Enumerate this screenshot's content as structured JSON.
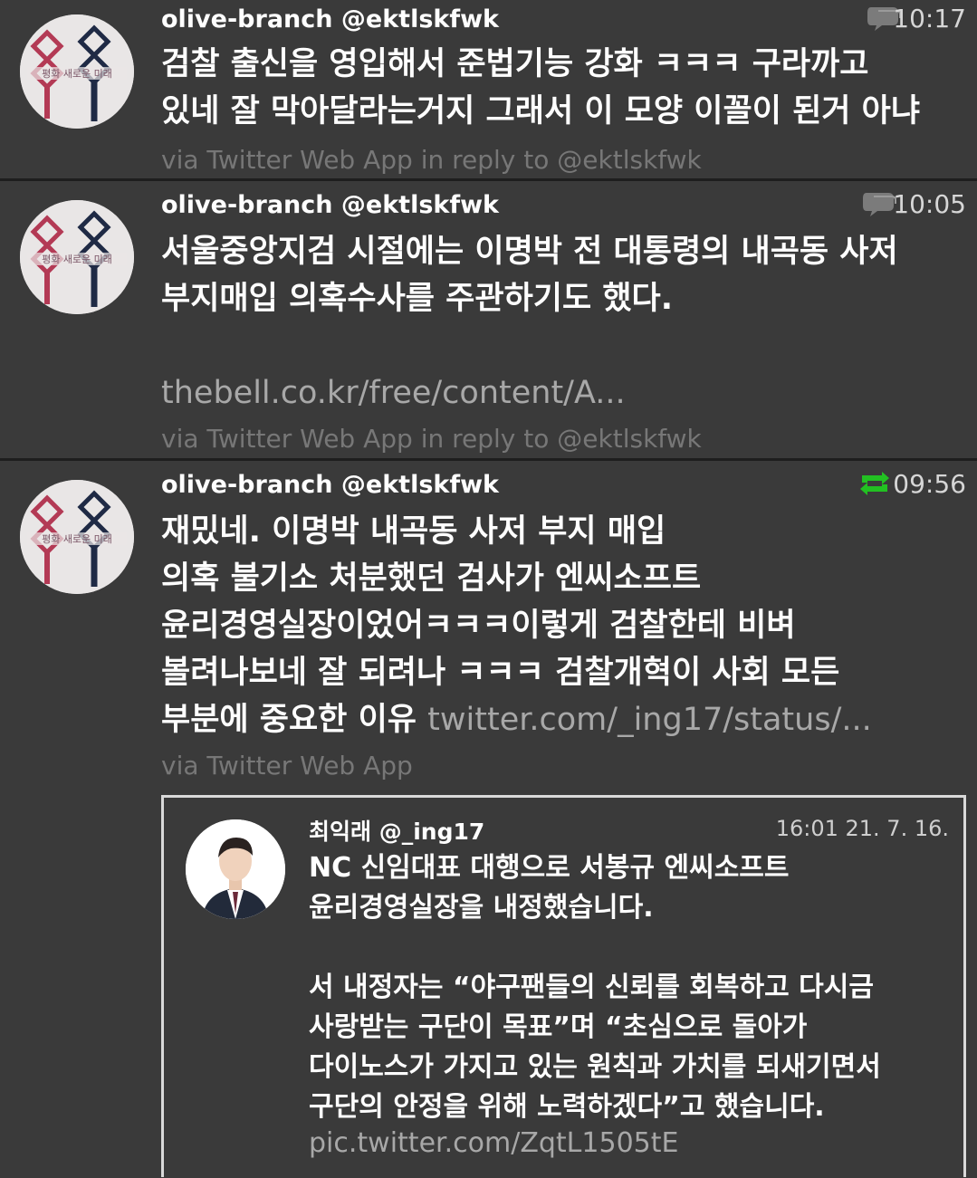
{
  "tweets": [
    {
      "user": "olive-branch @ektlskfwk",
      "time": "10:17",
      "icon": "reply-bubble-icon",
      "lines": [
        "검찰 출신을 영입해서 준법기능 강화 ㅋㅋㅋ 구라까고",
        "있네 잘 막아달라는거지 그래서 이 모양 이꼴이 된거 아냐"
      ],
      "via": "via Twitter Web App in reply to @ektlskfwk"
    },
    {
      "user": "olive-branch @ektlskfwk",
      "time": "10:05",
      "icon": "reply-bubble-icon",
      "lines": [
        "서울중앙지검 시절에는 이명박 전 대통령의 내곡동 사저",
        "부지매입 의혹수사를 주관하기도 했다."
      ],
      "link": "thebell.co.kr/free/content/A...",
      "via": "via Twitter Web App in reply to @ektlskfwk"
    },
    {
      "user": "olive-branch @ektlskfwk",
      "time": "09:56",
      "icon": "retweet-icon",
      "lines": [
        "재밌네. 이명박 내곡동 사저 부지 매입",
        "의혹 불기소 처분했던 검사가 엔씨소프트",
        "윤리경영실장이었어ㅋㅋㅋ이렇게 검찰한테 비벼",
        "볼려나보네 잘 되려나 ㅋㅋㅋ 검찰개혁이 사회 모든",
        "부분에 중요한 이유"
      ],
      "link": "twitter.com/_ing17/status/...",
      "via": "via Twitter Web App"
    }
  ],
  "quoted": {
    "user": "최익래 @_ing17",
    "time": "16:01 21. 7. 16.",
    "para1": [
      "NC 신임대표 대행으로 서봉규 엔씨소프트",
      "윤리경영실장을 내정했습니다."
    ],
    "para2": [
      "서 내정자는 “야구팬들의 신뢰를 회복하고 다시금",
      "사랑받는 구단이 목표”며 “초심으로 돌아가",
      "다이노스가 가지고 있는 원칙과 가치를 되새기면서",
      "구단의 안정을 위해 노력하겠다”고 했습니다."
    ],
    "link": "pic.twitter.com/ZqtL1505tE"
  },
  "colors": {
    "background": "#3a3a3a",
    "divider": "#1e1e1e",
    "retweet": "#22c022",
    "muted": "#777777"
  }
}
